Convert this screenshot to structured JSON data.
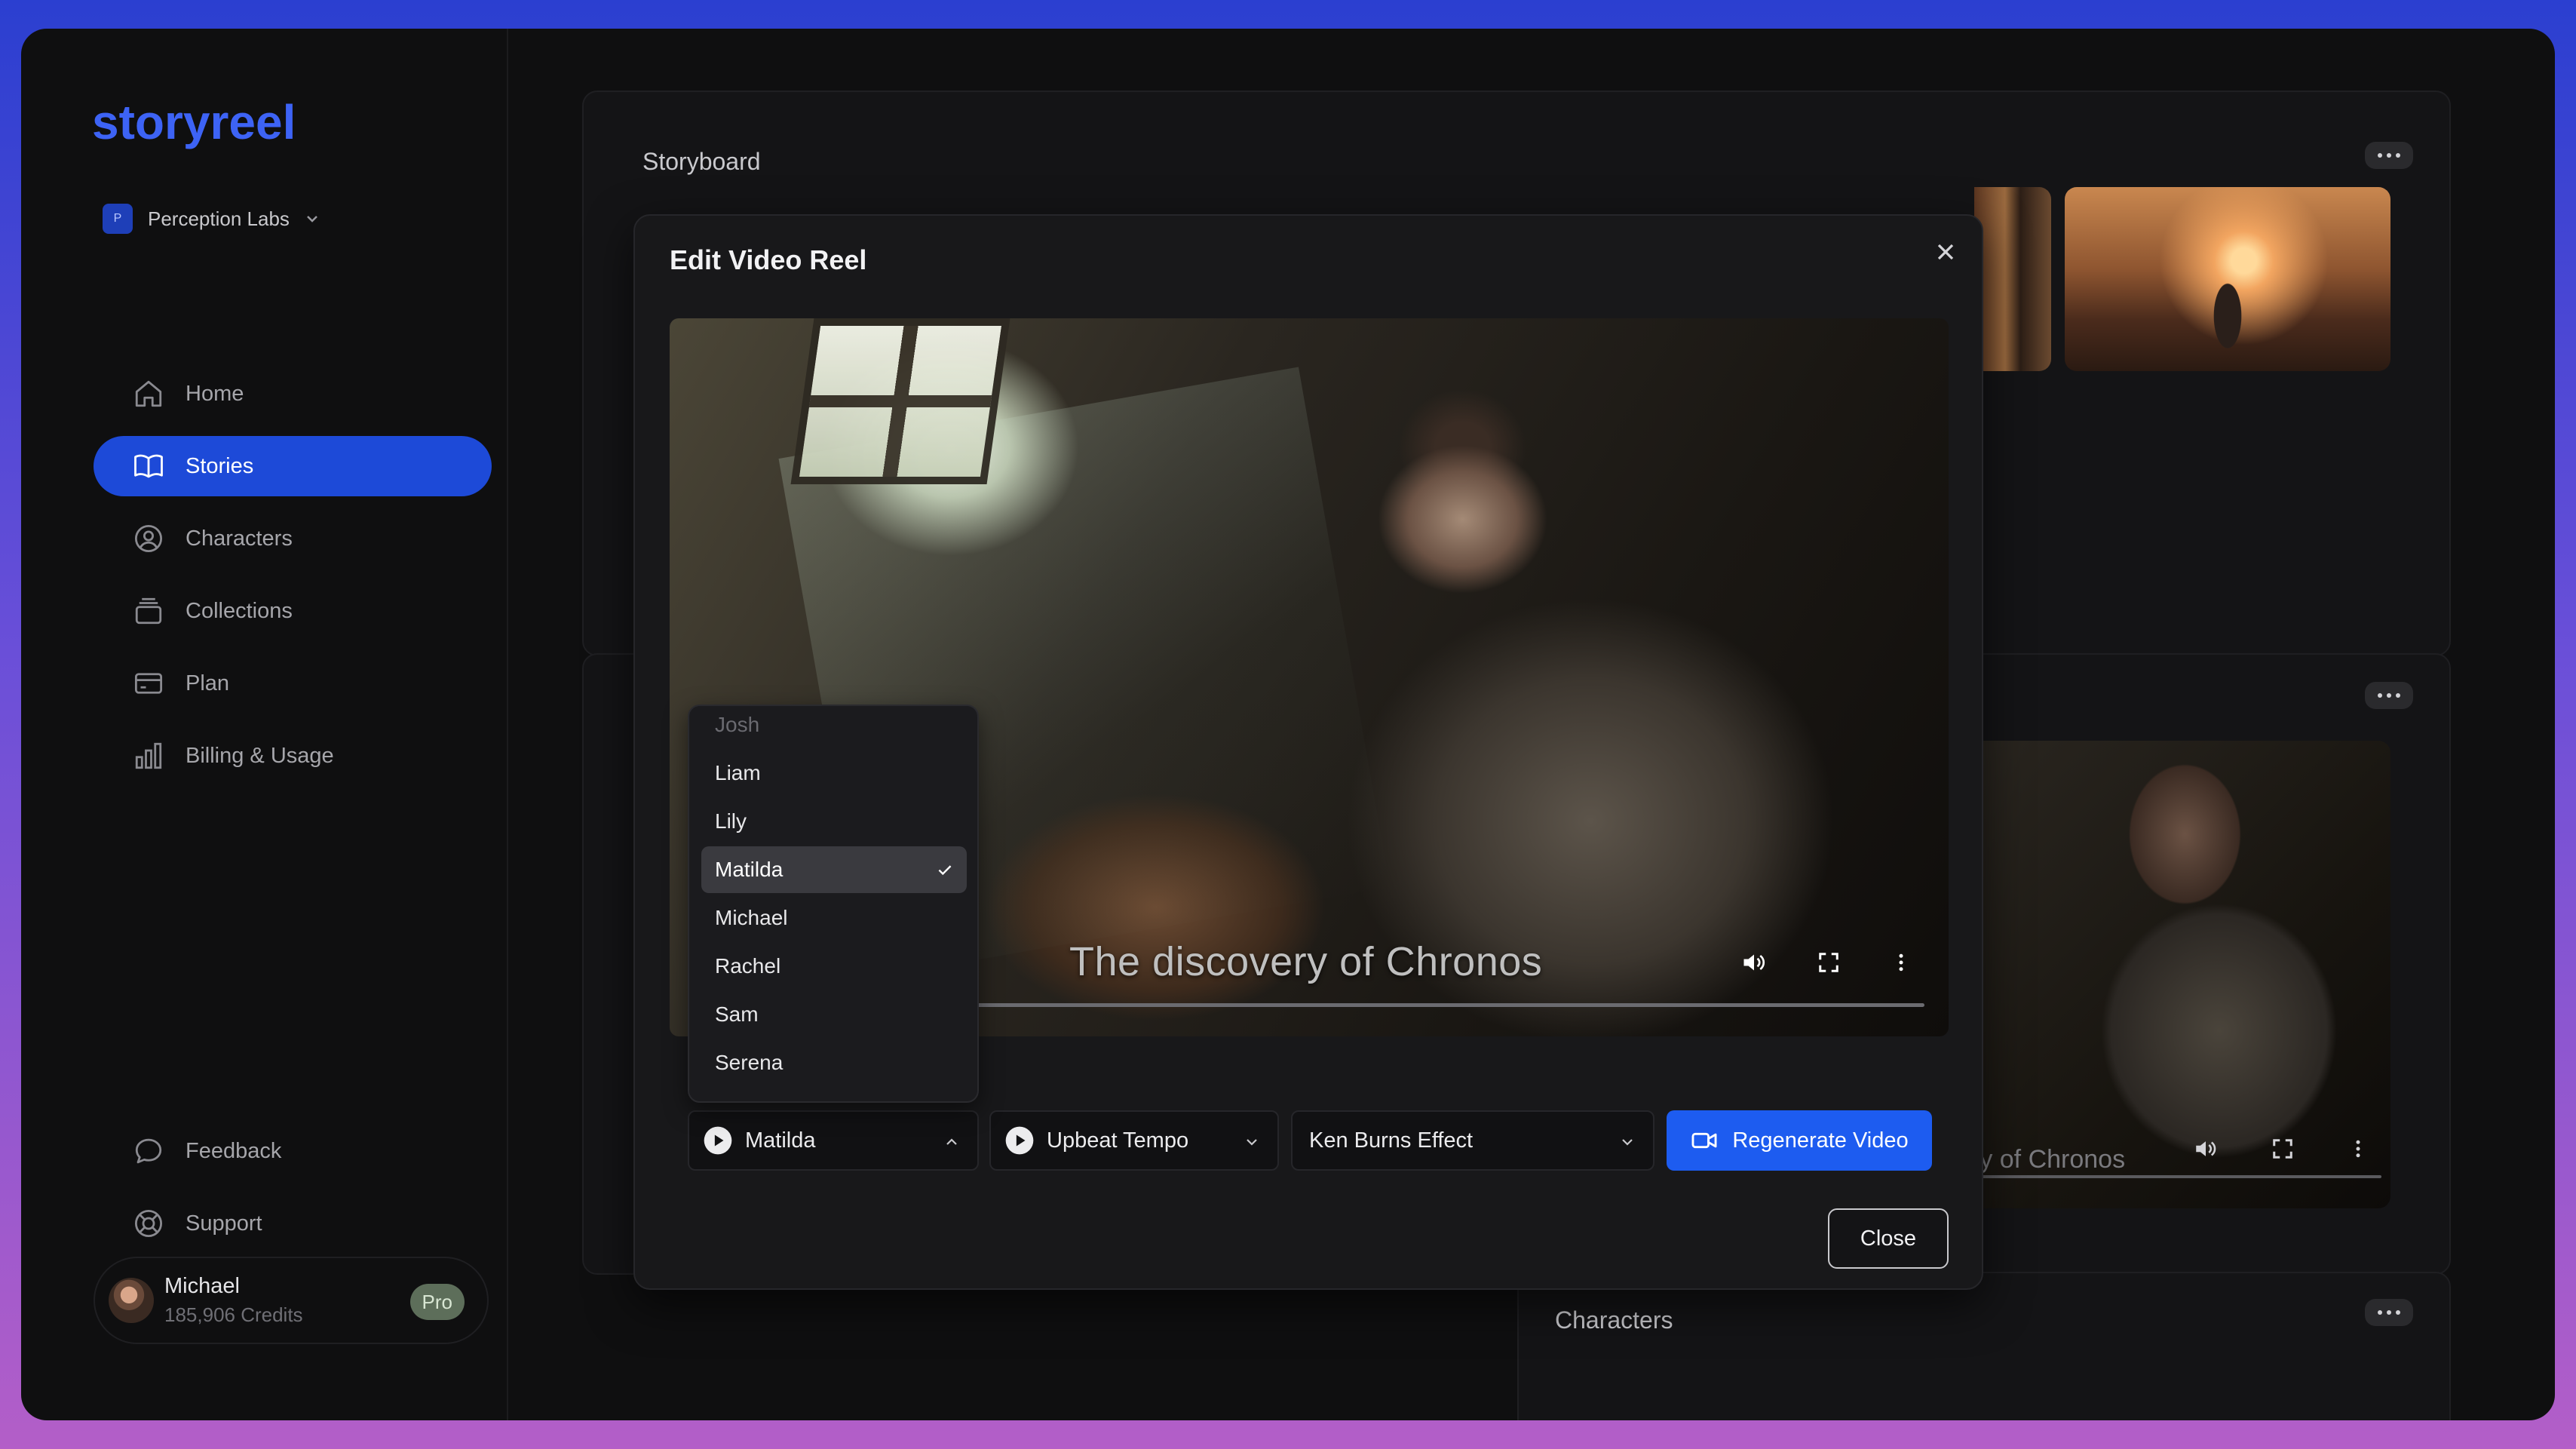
{
  "app": {
    "logo_text": "storyreel",
    "workspace": "Perception Labs"
  },
  "sidebar": {
    "items": [
      {
        "label": "Home",
        "icon": "home-icon"
      },
      {
        "label": "Stories",
        "icon": "book-icon",
        "active": true
      },
      {
        "label": "Characters",
        "icon": "user-circle-icon"
      },
      {
        "label": "Collections",
        "icon": "stack-icon"
      },
      {
        "label": "Plan",
        "icon": "credit-card-icon"
      },
      {
        "label": "Billing & Usage",
        "icon": "bar-chart-icon"
      }
    ],
    "bottom_items": [
      {
        "label": "Feedback",
        "icon": "chat-bubble-icon"
      },
      {
        "label": "Support",
        "icon": "lifebuoy-icon"
      }
    ]
  },
  "user": {
    "name": "Michael",
    "credits": "185,906 Credits",
    "plan_badge": "Pro"
  },
  "panels": {
    "storyboard_title": "Storyboard",
    "characters_title": "Characters",
    "background_video_caption": "ry of Chronos"
  },
  "modal": {
    "title": "Edit Video Reel",
    "video_caption": "The discovery of Chronos",
    "voice_select": "Matilda",
    "music_select": "Upbeat Tempo",
    "effect_select": "Ken Burns Effect",
    "regenerate_label": "Regenerate Video",
    "close_label": "Close"
  },
  "voice_dropdown": {
    "options": [
      "Josh",
      "Liam",
      "Lily",
      "Matilda",
      "Michael",
      "Rachel",
      "Sam",
      "Serena"
    ],
    "selected": "Matilda"
  },
  "colors": {
    "accent": "#1d5cf0",
    "nav_active": "#1d4ad8",
    "logo_blue": "#3d63f5",
    "pro_badge": "#5d6e5a"
  }
}
